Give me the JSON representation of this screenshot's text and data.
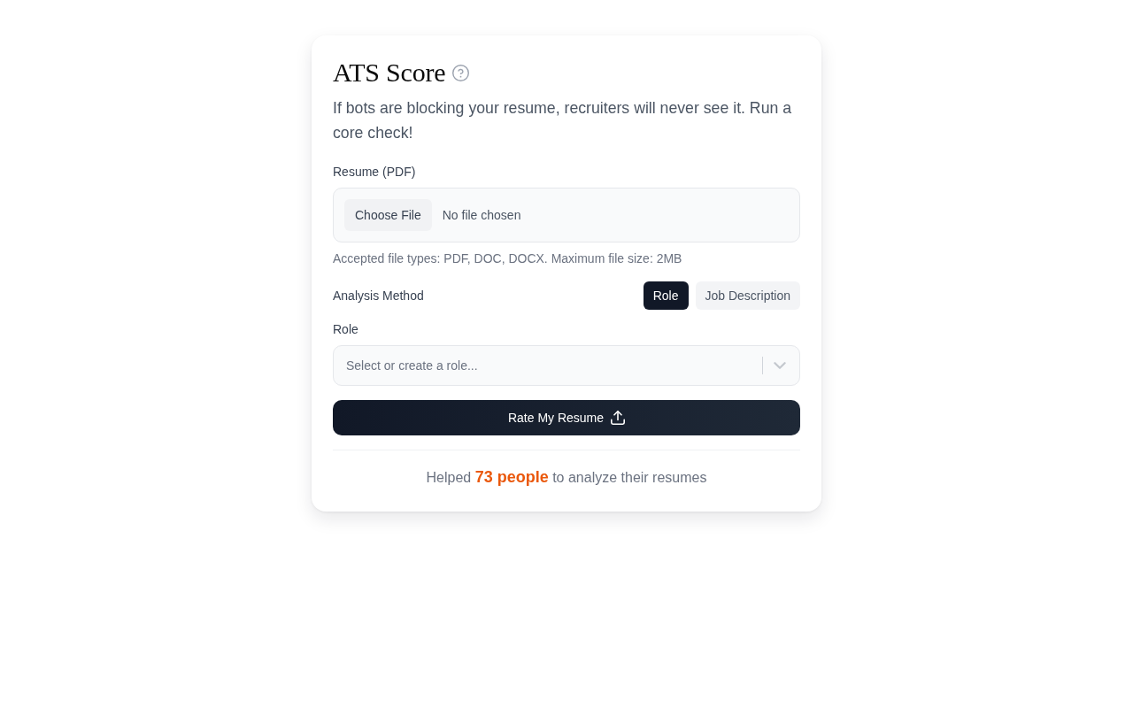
{
  "card": {
    "title": "ATS Score",
    "description": "If bots are blocking your resume, recruiters will never see it. Run a core check!",
    "resume_upload": {
      "label": "Resume (PDF)",
      "button": "Choose File",
      "status": "No file chosen",
      "hint": "Accepted file types: PDF, DOC, DOCX. Maximum file size: 2MB"
    },
    "analysis_method": {
      "label": "Analysis Method",
      "options": [
        {
          "label": "Role",
          "selected": true
        },
        {
          "label": "Job Description",
          "selected": false
        }
      ]
    },
    "role": {
      "label": "Role",
      "placeholder": "Select or create a role..."
    },
    "submit_button": "Rate My Resume",
    "footer": "Helped **73 people** to analyze their resumes"
  }
}
